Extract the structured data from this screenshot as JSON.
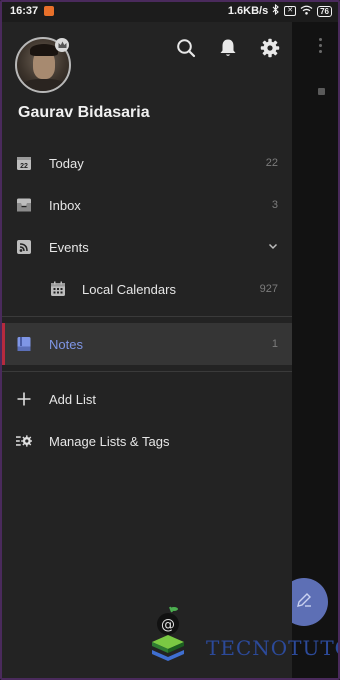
{
  "status_bar": {
    "time": "16:37",
    "network_speed": "1.6KB/s",
    "battery": "76"
  },
  "user": {
    "name": "Gaurav Bidasaria"
  },
  "header_icons": [
    "search-icon",
    "bell-icon",
    "gear-icon"
  ],
  "nav": {
    "today": {
      "label": "Today",
      "count": "22",
      "date_badge": "22"
    },
    "inbox": {
      "label": "Inbox",
      "count": "3"
    },
    "events": {
      "label": "Events"
    },
    "local_calendars": {
      "label": "Local Calendars",
      "count": "927"
    },
    "notes": {
      "label": "Notes",
      "count": "1"
    },
    "add_list": {
      "label": "Add List"
    },
    "manage_lists": {
      "label": "Manage Lists & Tags"
    }
  },
  "watermark": {
    "text": "TECNOTUTO"
  },
  "colors": {
    "accent": "#7f96e6",
    "active_bar": "#b62a3e",
    "fab": "#5d6fb5",
    "drawer_bg": "#232323"
  }
}
